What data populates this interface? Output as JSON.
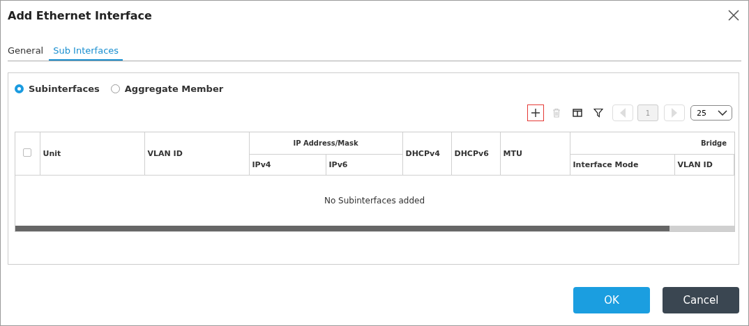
{
  "window": {
    "title": "Add Ethernet Interface"
  },
  "tabs": [
    {
      "label": "General",
      "selected": false
    },
    {
      "label": "Sub Interfaces",
      "selected": true
    }
  ],
  "radios": [
    {
      "label": "Subinterfaces",
      "selected": true
    },
    {
      "label": "Aggregate Member",
      "selected": false
    }
  ],
  "toolbar": {
    "add_highlighted": true,
    "delete_disabled": true,
    "prev_disabled": true,
    "next_disabled": true,
    "page": "1",
    "page_size": "25"
  },
  "table": {
    "select_all_checked": false,
    "columns": [
      {
        "label": "Unit"
      },
      {
        "label": "VLAN ID"
      },
      {
        "label": "IP Address/Mask",
        "children": [
          "IPv4",
          "IPv6"
        ]
      },
      {
        "label": "DHCPv4"
      },
      {
        "label": "DHCPv6"
      },
      {
        "label": "MTU"
      },
      {
        "label": "Bridge",
        "children": [
          "Interface Mode",
          "VLAN ID"
        ]
      }
    ],
    "empty_message": "No Subinterfaces added"
  },
  "buttons": [
    {
      "label": "OK",
      "kind": "primary"
    },
    {
      "label": "Cancel",
      "kind": "secondary"
    }
  ]
}
